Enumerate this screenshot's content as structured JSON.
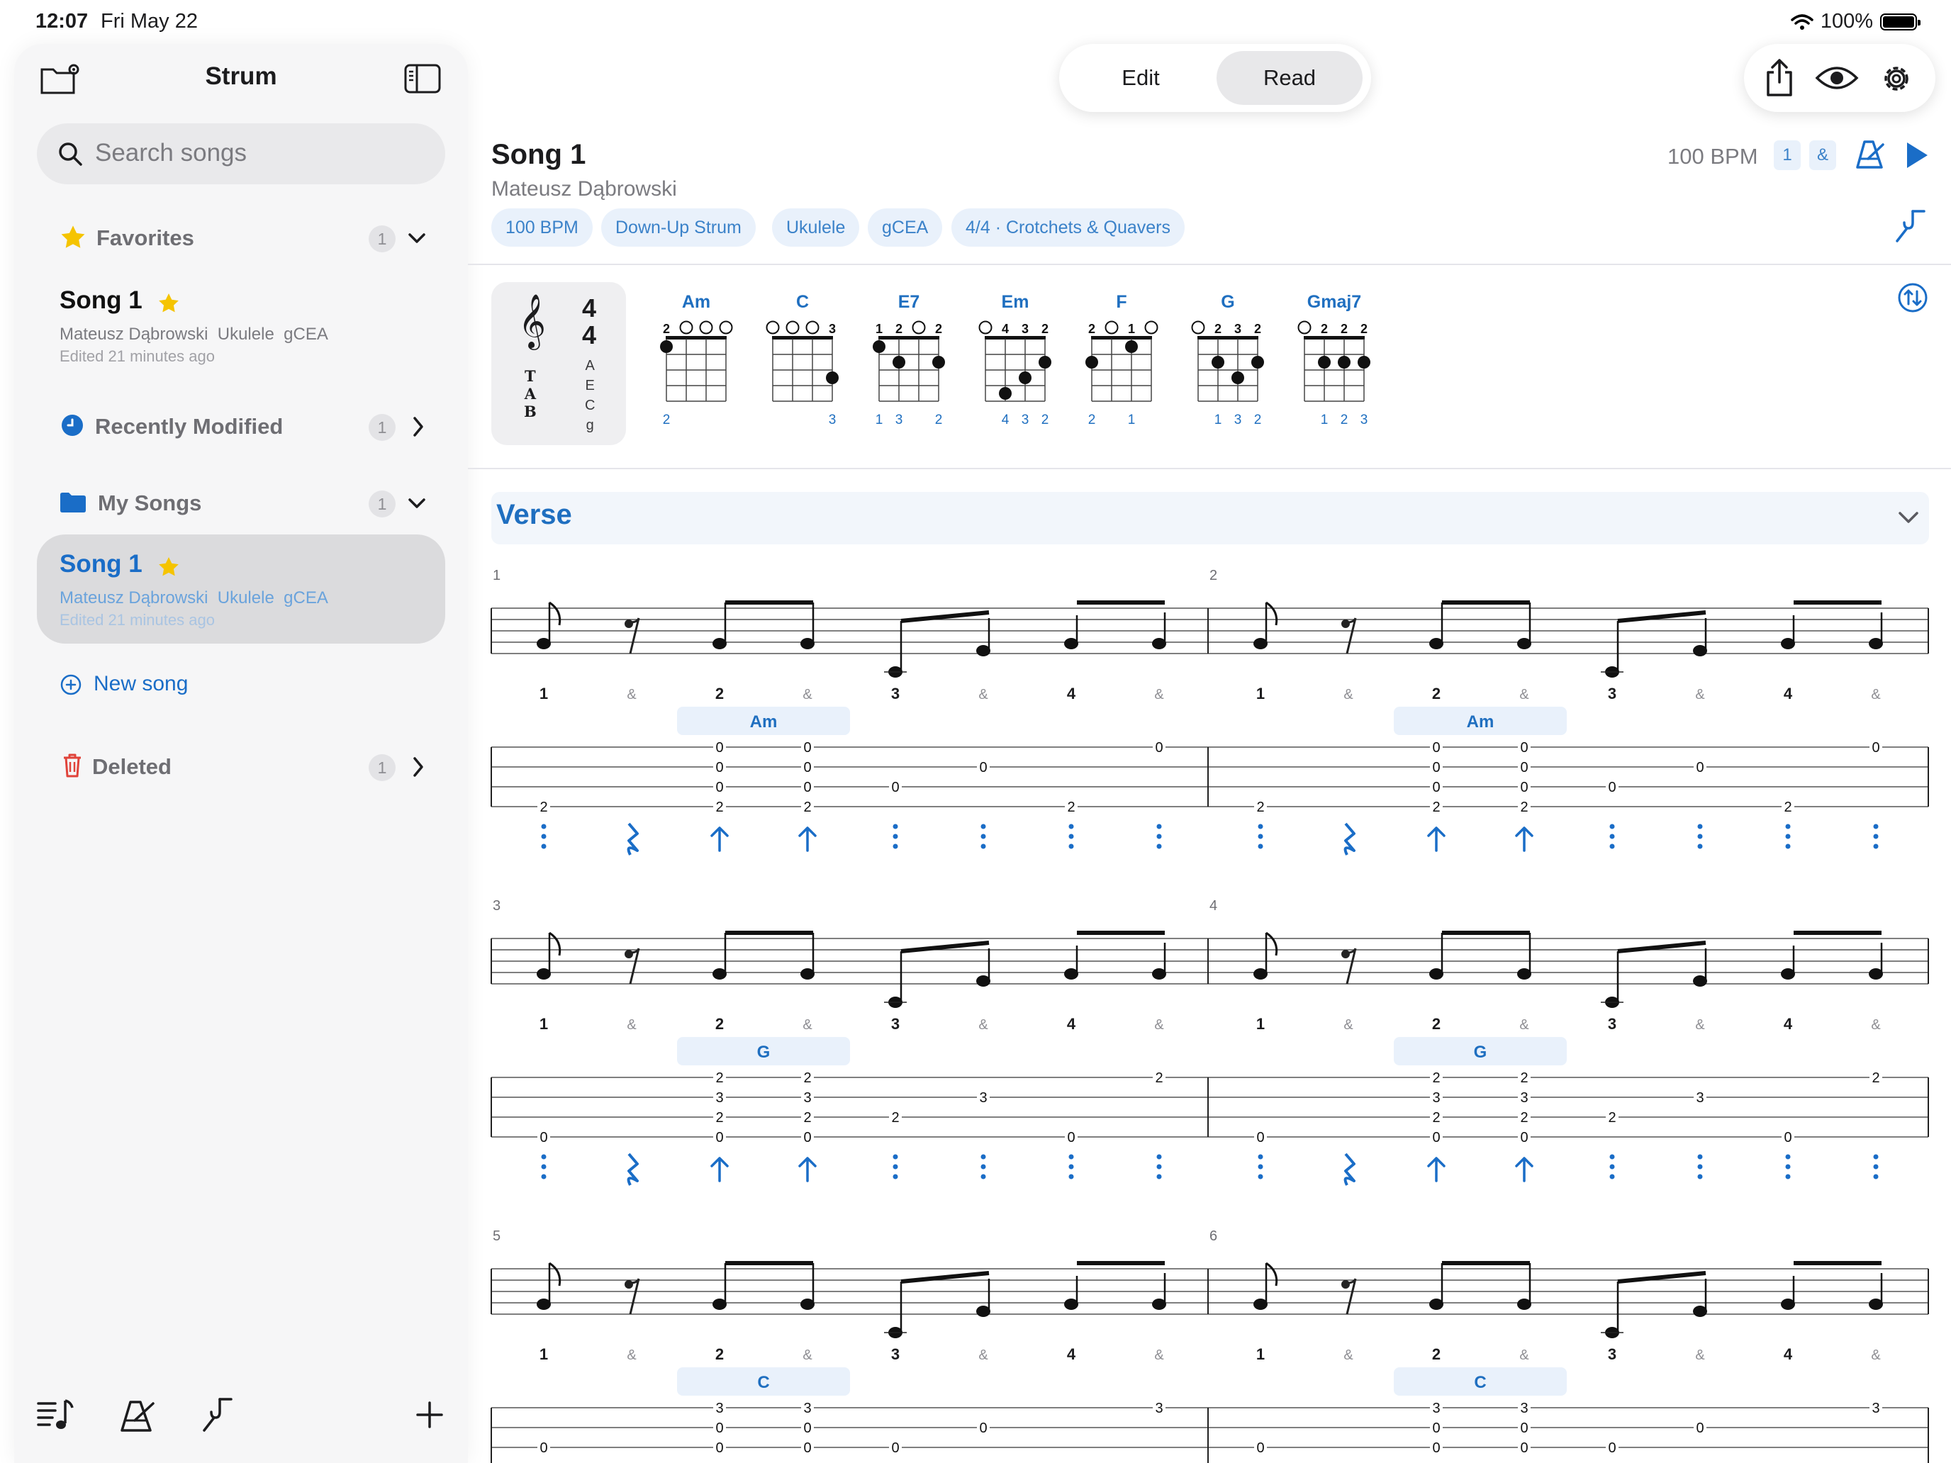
{
  "status": {
    "time": "12:07",
    "date": "Fri May 22",
    "battery": "100%"
  },
  "sidebar": {
    "title": "Strum",
    "search_placeholder": "Search songs",
    "favorites": {
      "label": "Favorites",
      "count": "1"
    },
    "fav_song": {
      "title": "Song 1",
      "artist": "Mateusz Dąbrowski",
      "instrument": "Ukulele",
      "tuning": "gCEA",
      "edited": "Edited 21 minutes ago"
    },
    "recent": {
      "label": "Recently Modified",
      "count": "1"
    },
    "mysongs": {
      "label": "My Songs",
      "count": "1"
    },
    "sel_song": {
      "title": "Song 1",
      "artist": "Mateusz Dąbrowski",
      "instrument": "Ukulele",
      "tuning": "gCEA",
      "edited": "Edited 21 minutes ago"
    },
    "new_song": "New song",
    "deleted": {
      "label": "Deleted",
      "count": "1"
    }
  },
  "mode": {
    "edit": "Edit",
    "read": "Read",
    "active": "Read"
  },
  "song": {
    "title": "Song 1",
    "artist": "Mateusz Dąbrowski",
    "chips": [
      "100 BPM",
      "Down-Up Strum",
      "Ukulele",
      "gCEA",
      "4/4 · Crotchets & Quavers"
    ],
    "bpm": "100 BPM",
    "badge_1": "1",
    "badge_and": "&"
  },
  "timesig": {
    "top": "4",
    "bottom": "4",
    "tab": [
      "T",
      "A",
      "B"
    ],
    "strings": [
      "A",
      "E",
      "C",
      "g"
    ]
  },
  "chords": [
    {
      "name": "Am",
      "top": [
        "2",
        "o",
        "o",
        "o"
      ],
      "dots": [
        [
          0,
          1
        ]
      ],
      "fingers": [
        "2",
        "",
        "",
        ""
      ]
    },
    {
      "name": "C",
      "top": [
        "o",
        "o",
        "o",
        "3"
      ],
      "dots": [
        [
          3,
          3
        ]
      ],
      "fingers": [
        "",
        "",
        "",
        "3"
      ]
    },
    {
      "name": "E7",
      "top": [
        "1",
        "2",
        "o",
        "2"
      ],
      "dots": [
        [
          0,
          1
        ],
        [
          1,
          2
        ],
        [
          3,
          2
        ]
      ],
      "fingers": [
        "1",
        "3",
        "",
        "2"
      ]
    },
    {
      "name": "Em",
      "top": [
        "o",
        "4",
        "3",
        "2"
      ],
      "dots": [
        [
          1,
          4
        ],
        [
          2,
          3
        ],
        [
          3,
          2
        ]
      ],
      "fingers": [
        "",
        "4",
        "3",
        "2"
      ]
    },
    {
      "name": "F",
      "top": [
        "2",
        "o",
        "1",
        "o"
      ],
      "dots": [
        [
          0,
          2
        ],
        [
          2,
          1
        ]
      ],
      "fingers": [
        "2",
        "",
        "1",
        ""
      ]
    },
    {
      "name": "G",
      "top": [
        "o",
        "2",
        "3",
        "2"
      ],
      "dots": [
        [
          1,
          2
        ],
        [
          2,
          3
        ],
        [
          3,
          2
        ]
      ],
      "fingers": [
        "",
        "1",
        "3",
        "2"
      ]
    },
    {
      "name": "Gmaj7",
      "top": [
        "o",
        "2",
        "2",
        "2"
      ],
      "dots": [
        [
          1,
          2
        ],
        [
          2,
          2
        ],
        [
          3,
          2
        ]
      ],
      "fingers": [
        "",
        "1",
        "2",
        "3"
      ]
    }
  ],
  "section": "Verse",
  "counts": [
    "1",
    "&",
    "2",
    "&",
    "3",
    "&",
    "4",
    "&"
  ],
  "systems": [
    {
      "measures": [
        "1",
        "2"
      ],
      "chord": "Am",
      "tab": [
        [
          "",
          "",
          "0",
          "0",
          "",
          "",
          "",
          "0"
        ],
        [
          "",
          "",
          "0",
          "0",
          "",
          "0",
          "",
          ""
        ],
        [
          "",
          "",
          "0",
          "0",
          "0",
          "",
          "",
          ""
        ],
        [
          "2",
          "",
          "2",
          "2",
          "",
          "",
          "2",
          ""
        ]
      ]
    },
    {
      "measures": [
        "3",
        "4"
      ],
      "chord": "G",
      "tab": [
        [
          "",
          "",
          "2",
          "2",
          "",
          "",
          "",
          "2"
        ],
        [
          "",
          "",
          "3",
          "3",
          "",
          "3",
          "",
          ""
        ],
        [
          "",
          "",
          "2",
          "2",
          "2",
          "",
          "",
          ""
        ],
        [
          "0",
          "",
          "0",
          "0",
          "",
          "",
          "0",
          ""
        ]
      ]
    },
    {
      "measures": [
        "5",
        "6"
      ],
      "chord": "C",
      "tab": [
        [
          "",
          "",
          "3",
          "3",
          "",
          "",
          "",
          "3"
        ],
        [
          "",
          "",
          "0",
          "0",
          "",
          "0",
          "",
          ""
        ],
        [
          "0",
          "",
          "0",
          "0",
          "0",
          "",
          "",
          ""
        ]
      ]
    }
  ]
}
